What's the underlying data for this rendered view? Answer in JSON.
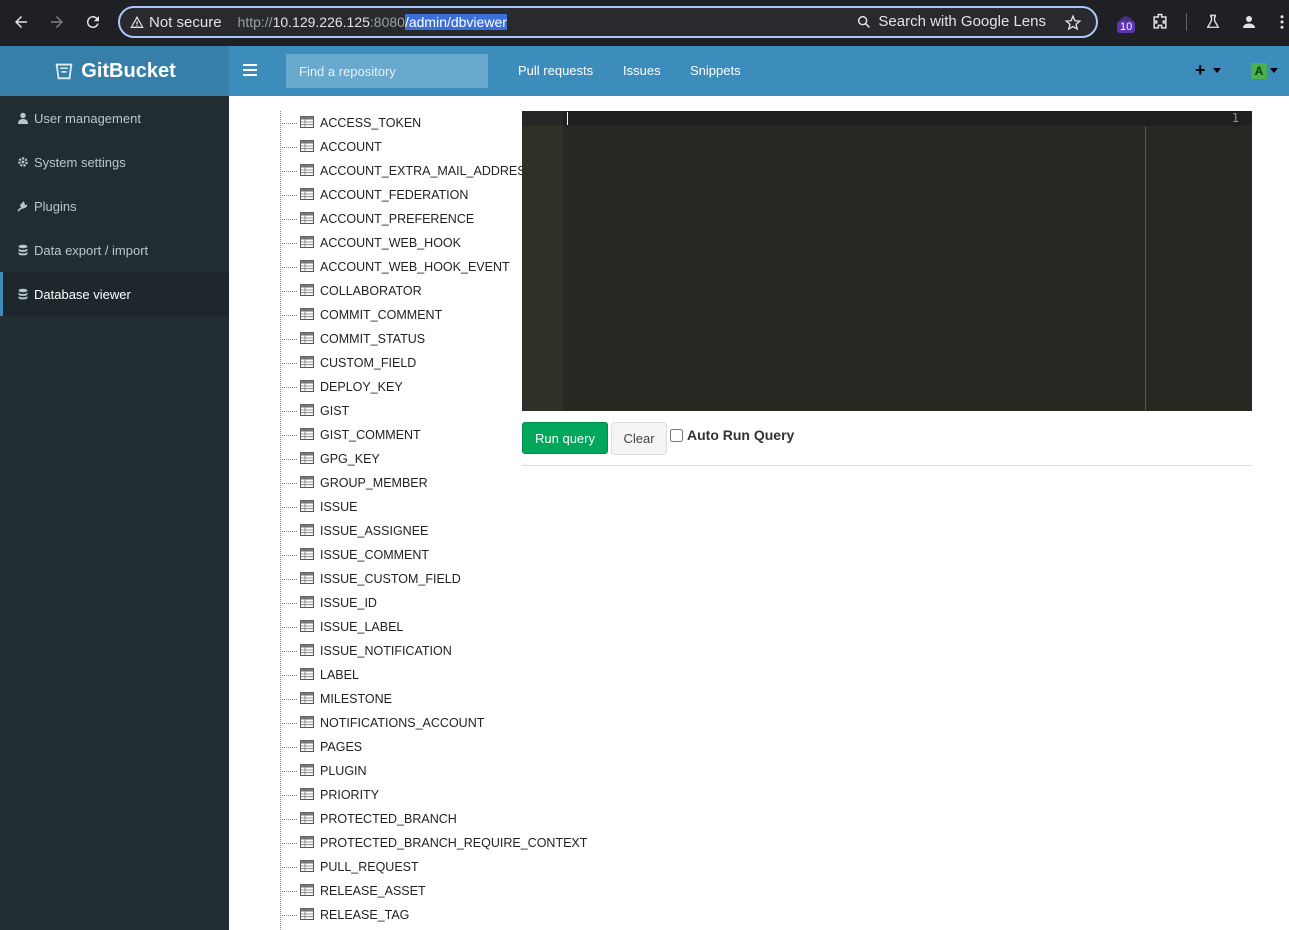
{
  "browser": {
    "not_secure_label": "Not secure",
    "url": {
      "protocol": "http://",
      "host": "10.129.226.125",
      "port": ":8080",
      "path": "/admin/dbviewer"
    },
    "lens_label": "Search with Google Lens",
    "extension_badge": "10"
  },
  "header": {
    "brand": "GitBucket",
    "search_placeholder": "Find a repository",
    "links": {
      "pull_requests": "Pull requests",
      "issues": "Issues",
      "snippets": "Snippets"
    },
    "plus_label": "+",
    "avatar_letter": "A",
    "colors": {
      "header": "#3c8dbc",
      "logo_bg": "#367fa9"
    }
  },
  "sidebar": {
    "items": [
      {
        "label": "User management",
        "icon": "user-icon"
      },
      {
        "label": "System settings",
        "icon": "gear-icon"
      },
      {
        "label": "Plugins",
        "icon": "plug-icon"
      },
      {
        "label": "Data export / import",
        "icon": "database-icon"
      },
      {
        "label": "Database viewer",
        "icon": "database-icon",
        "active": true
      }
    ]
  },
  "tables": [
    "ACCESS_TOKEN",
    "ACCOUNT",
    "ACCOUNT_EXTRA_MAIL_ADDRESS",
    "ACCOUNT_FEDERATION",
    "ACCOUNT_PREFERENCE",
    "ACCOUNT_WEB_HOOK",
    "ACCOUNT_WEB_HOOK_EVENT",
    "COLLABORATOR",
    "COMMIT_COMMENT",
    "COMMIT_STATUS",
    "CUSTOM_FIELD",
    "DEPLOY_KEY",
    "GIST",
    "GIST_COMMENT",
    "GPG_KEY",
    "GROUP_MEMBER",
    "ISSUE",
    "ISSUE_ASSIGNEE",
    "ISSUE_COMMENT",
    "ISSUE_CUSTOM_FIELD",
    "ISSUE_ID",
    "ISSUE_LABEL",
    "ISSUE_NOTIFICATION",
    "LABEL",
    "MILESTONE",
    "NOTIFICATIONS_ACCOUNT",
    "PAGES",
    "PLUGIN",
    "PRIORITY",
    "PROTECTED_BRANCH",
    "PROTECTED_BRANCH_REQUIRE_CONTEXT",
    "PULL_REQUEST",
    "RELEASE_ASSET",
    "RELEASE_TAG"
  ],
  "editor": {
    "line_number": "1",
    "content": ""
  },
  "actions": {
    "run_query": "Run query",
    "clear": "Clear",
    "auto_run_label": "Auto Run Query",
    "auto_run_checked": false
  }
}
